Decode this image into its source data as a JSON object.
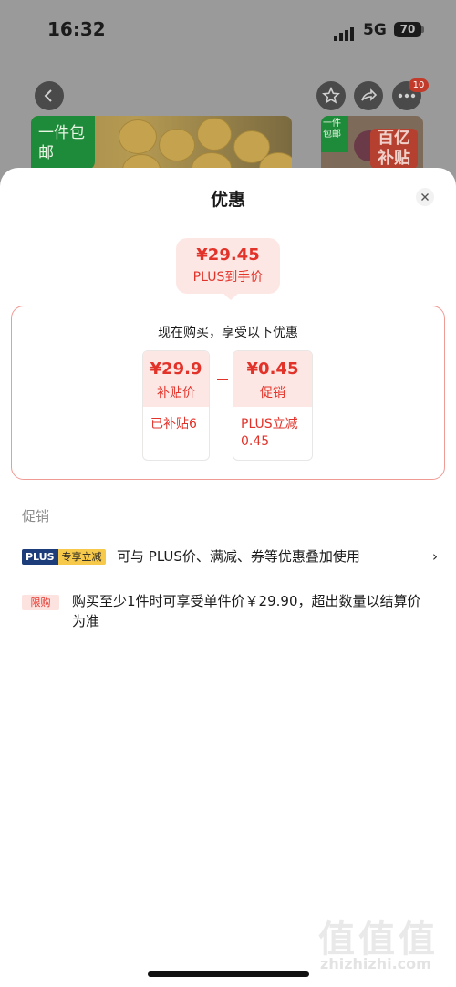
{
  "status_bar": {
    "time": "16:32",
    "network": "5G",
    "battery": "70"
  },
  "top_nav": {
    "badge_count": "10"
  },
  "banners": {
    "left_tag": "一件包邮",
    "right_tag_small": "一件包邮",
    "right_tag": "百亿补贴"
  },
  "sheet": {
    "title": "优惠",
    "plus_price": {
      "amount": "¥29.45",
      "label": "PLUS到手价"
    },
    "calc_heading": "现在购买，享受以下优惠",
    "items": [
      {
        "amount": "¥29.9",
        "label": "补贴价",
        "note": "已补贴6"
      },
      {
        "amount": "¥0.45",
        "label": "促销",
        "note": "PLUS立减0.45"
      }
    ],
    "promo_section_title": "促销",
    "promos": [
      {
        "badge_left": "PLUS",
        "badge_right": "专享立减",
        "text": "可与 PLUS价、满减、券等优惠叠加使用",
        "chevron": "›"
      },
      {
        "badge": "限购",
        "text": "购买至少1件时可享受单件价￥29.90，超出数量以结算价为准"
      }
    ]
  },
  "watermark": {
    "glyphs": "值值值",
    "text": "zhizhizhi.com"
  },
  "colors": {
    "accent": "#e2332a",
    "accent_bg": "#fde7e4",
    "plus_blue": "#1c3c7a",
    "plus_gold": "#f6c94a"
  }
}
